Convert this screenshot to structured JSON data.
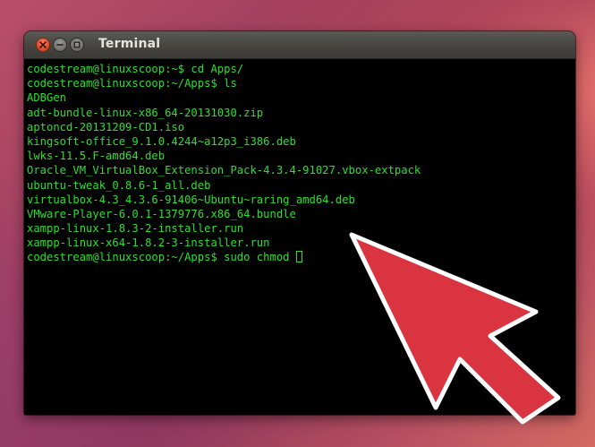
{
  "window": {
    "title": "Terminal",
    "buttons": {
      "close": "close-icon",
      "minimize": "minimize-icon",
      "maximize": "maximize-icon"
    }
  },
  "terminal": {
    "lines": [
      "codestream@linuxscoop:~$ cd Apps/",
      "codestream@linuxscoop:~/Apps$ ls",
      "ADBGen",
      "adt-bundle-linux-x86_64-20131030.zip",
      "aptoncd-20131209-CD1.iso",
      "kingsoft-office_9.1.0.4244~a12p3_i386.deb",
      "lwks-11.5.F-amd64.deb",
      "Oracle_VM_VirtualBox_Extension_Pack-4.3.4-91027.vbox-extpack",
      "ubuntu-tweak_0.8.6-1_all.deb",
      "virtualbox-4.3_4.3.6-91406~Ubuntu~raring_amd64.deb",
      "VMware-Player-6.0.1-1379776.x86_64.bundle",
      "xampp-linux-1.8.3-2-installer.run",
      "xampp-linux-x64-1.8.2-3-installer.run"
    ],
    "current_prompt": "codestream@linuxscoop:~/Apps$ ",
    "current_input": "sudo chmod ",
    "text_color": "#2fdf2f",
    "background_color": "#000000"
  },
  "annotation": {
    "arrow_color": "#d9343f",
    "arrow_outline": "#ffffff",
    "arrow_direction": "up-left"
  }
}
